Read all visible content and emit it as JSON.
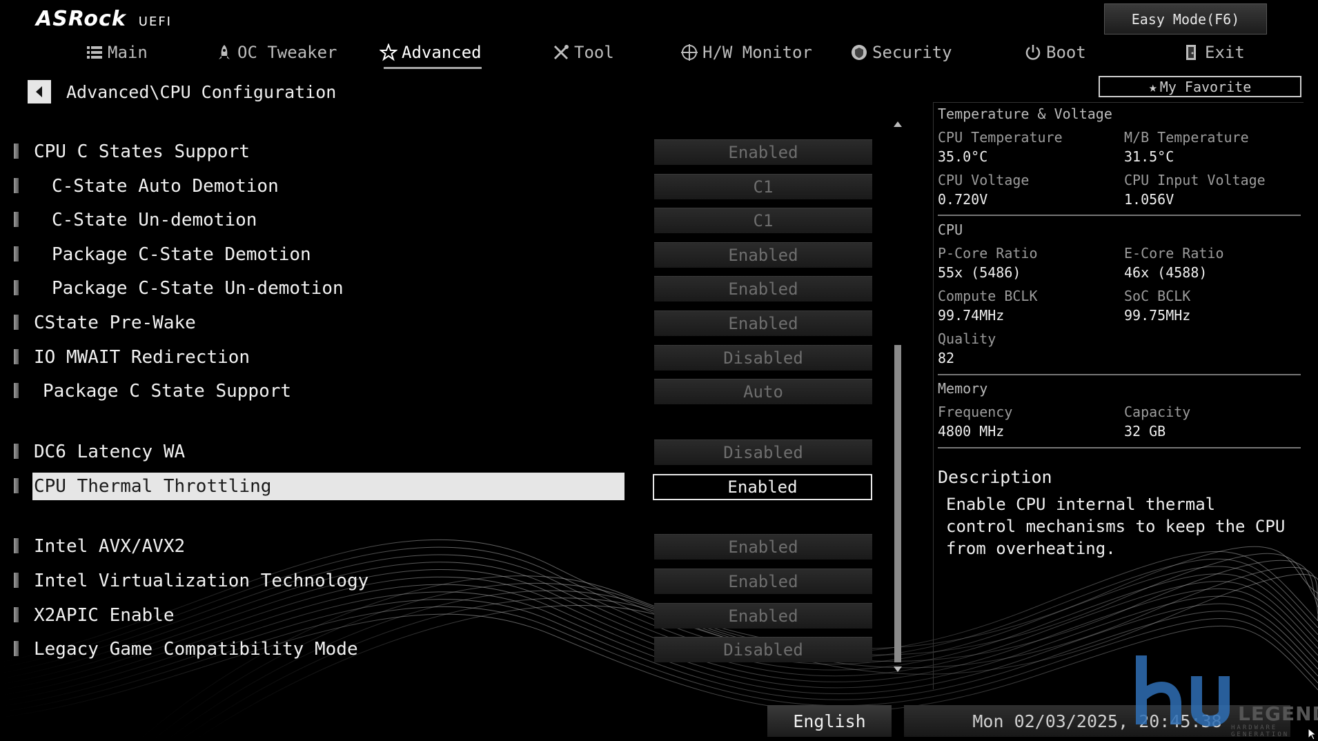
{
  "header": {
    "brand": "ASRock",
    "product": "UEFI",
    "easy_mode_label": "Easy Mode(F6)",
    "my_favorite_label": "My Favorite"
  },
  "tabs": [
    {
      "label": "Main",
      "icon": "list-icon",
      "active": false
    },
    {
      "label": "OC Tweaker",
      "icon": "rocket-icon",
      "active": false
    },
    {
      "label": "Advanced",
      "icon": "star-icon",
      "active": true
    },
    {
      "label": "Tool",
      "icon": "tools-icon",
      "active": false
    },
    {
      "label": "H/W Monitor",
      "icon": "crosshair-icon",
      "active": false
    },
    {
      "label": "Security",
      "icon": "shield-icon",
      "active": false
    },
    {
      "label": "Boot",
      "icon": "power-icon",
      "active": false
    },
    {
      "label": "Exit",
      "icon": "exit-door-icon",
      "active": false
    }
  ],
  "breadcrumb": "Advanced\\CPU Configuration",
  "settings": [
    {
      "label": "CPU C States Support",
      "value": "Enabled"
    },
    {
      "label": "C-State Auto Demotion",
      "value": "C1"
    },
    {
      "label": "C-State Un-demotion",
      "value": "C1"
    },
    {
      "label": "Package C-State Demotion",
      "value": "Enabled"
    },
    {
      "label": "Package C-State Un-demotion",
      "value": "Enabled"
    },
    {
      "label": "CState Pre-Wake",
      "value": "Enabled"
    },
    {
      "label": "IO MWAIT Redirection",
      "value": "Disabled"
    },
    {
      "label": "Package C State Support",
      "value": "Auto"
    },
    {
      "label": "DC6 Latency WA",
      "value": "Disabled"
    },
    {
      "label": "CPU Thermal Throttling",
      "value": "Enabled",
      "selected": true
    },
    {
      "label": "Intel AVX/AVX2",
      "value": "Enabled"
    },
    {
      "label": "Intel Virtualization Technology",
      "value": "Enabled"
    },
    {
      "label": "X2APIC Enable",
      "value": "Enabled"
    },
    {
      "label": "Legacy Game Compatibility Mode",
      "value": "Disabled"
    }
  ],
  "info": {
    "temp_voltage": {
      "title": "Temperature & Voltage",
      "cpu_temp_label": "CPU Temperature",
      "cpu_temp": "35.0°C",
      "mb_temp_label": "M/B Temperature",
      "mb_temp": "31.5°C",
      "cpu_voltage_label": "CPU Voltage",
      "cpu_voltage": "0.720V",
      "cpu_input_voltage_label": "CPU Input Voltage",
      "cpu_input_voltage": "1.056V"
    },
    "cpu": {
      "title": "CPU",
      "pcore_label": "P-Core Ratio",
      "pcore": "55x (5486)",
      "ecore_label": "E-Core Ratio",
      "ecore": "46x (4588)",
      "compute_bclk_label": "Compute BCLK",
      "compute_bclk": "99.74MHz",
      "soc_bclk_label": "SoC BCLK",
      "soc_bclk": "99.75MHz",
      "quality_label": "Quality",
      "quality": "82"
    },
    "memory": {
      "title": "Memory",
      "frequency_label": "Frequency",
      "frequency": "4800 MHz",
      "capacity_label": "Capacity",
      "capacity": "32 GB"
    },
    "description_title": "Description",
    "description": "Enable CPU internal thermal control mechanisms to keep the CPU from overheating."
  },
  "footer": {
    "language": "English",
    "datetime": "Mon 02/03/2025, 20:45:38"
  },
  "watermark": {
    "text": "LEGEND",
    "sub": "HARDWARE GENERATION"
  },
  "colors": {
    "background": "#000000",
    "text": "#f2f2f2",
    "value_disabled": "#6e6e6e",
    "highlight": "#e6e6e6"
  }
}
